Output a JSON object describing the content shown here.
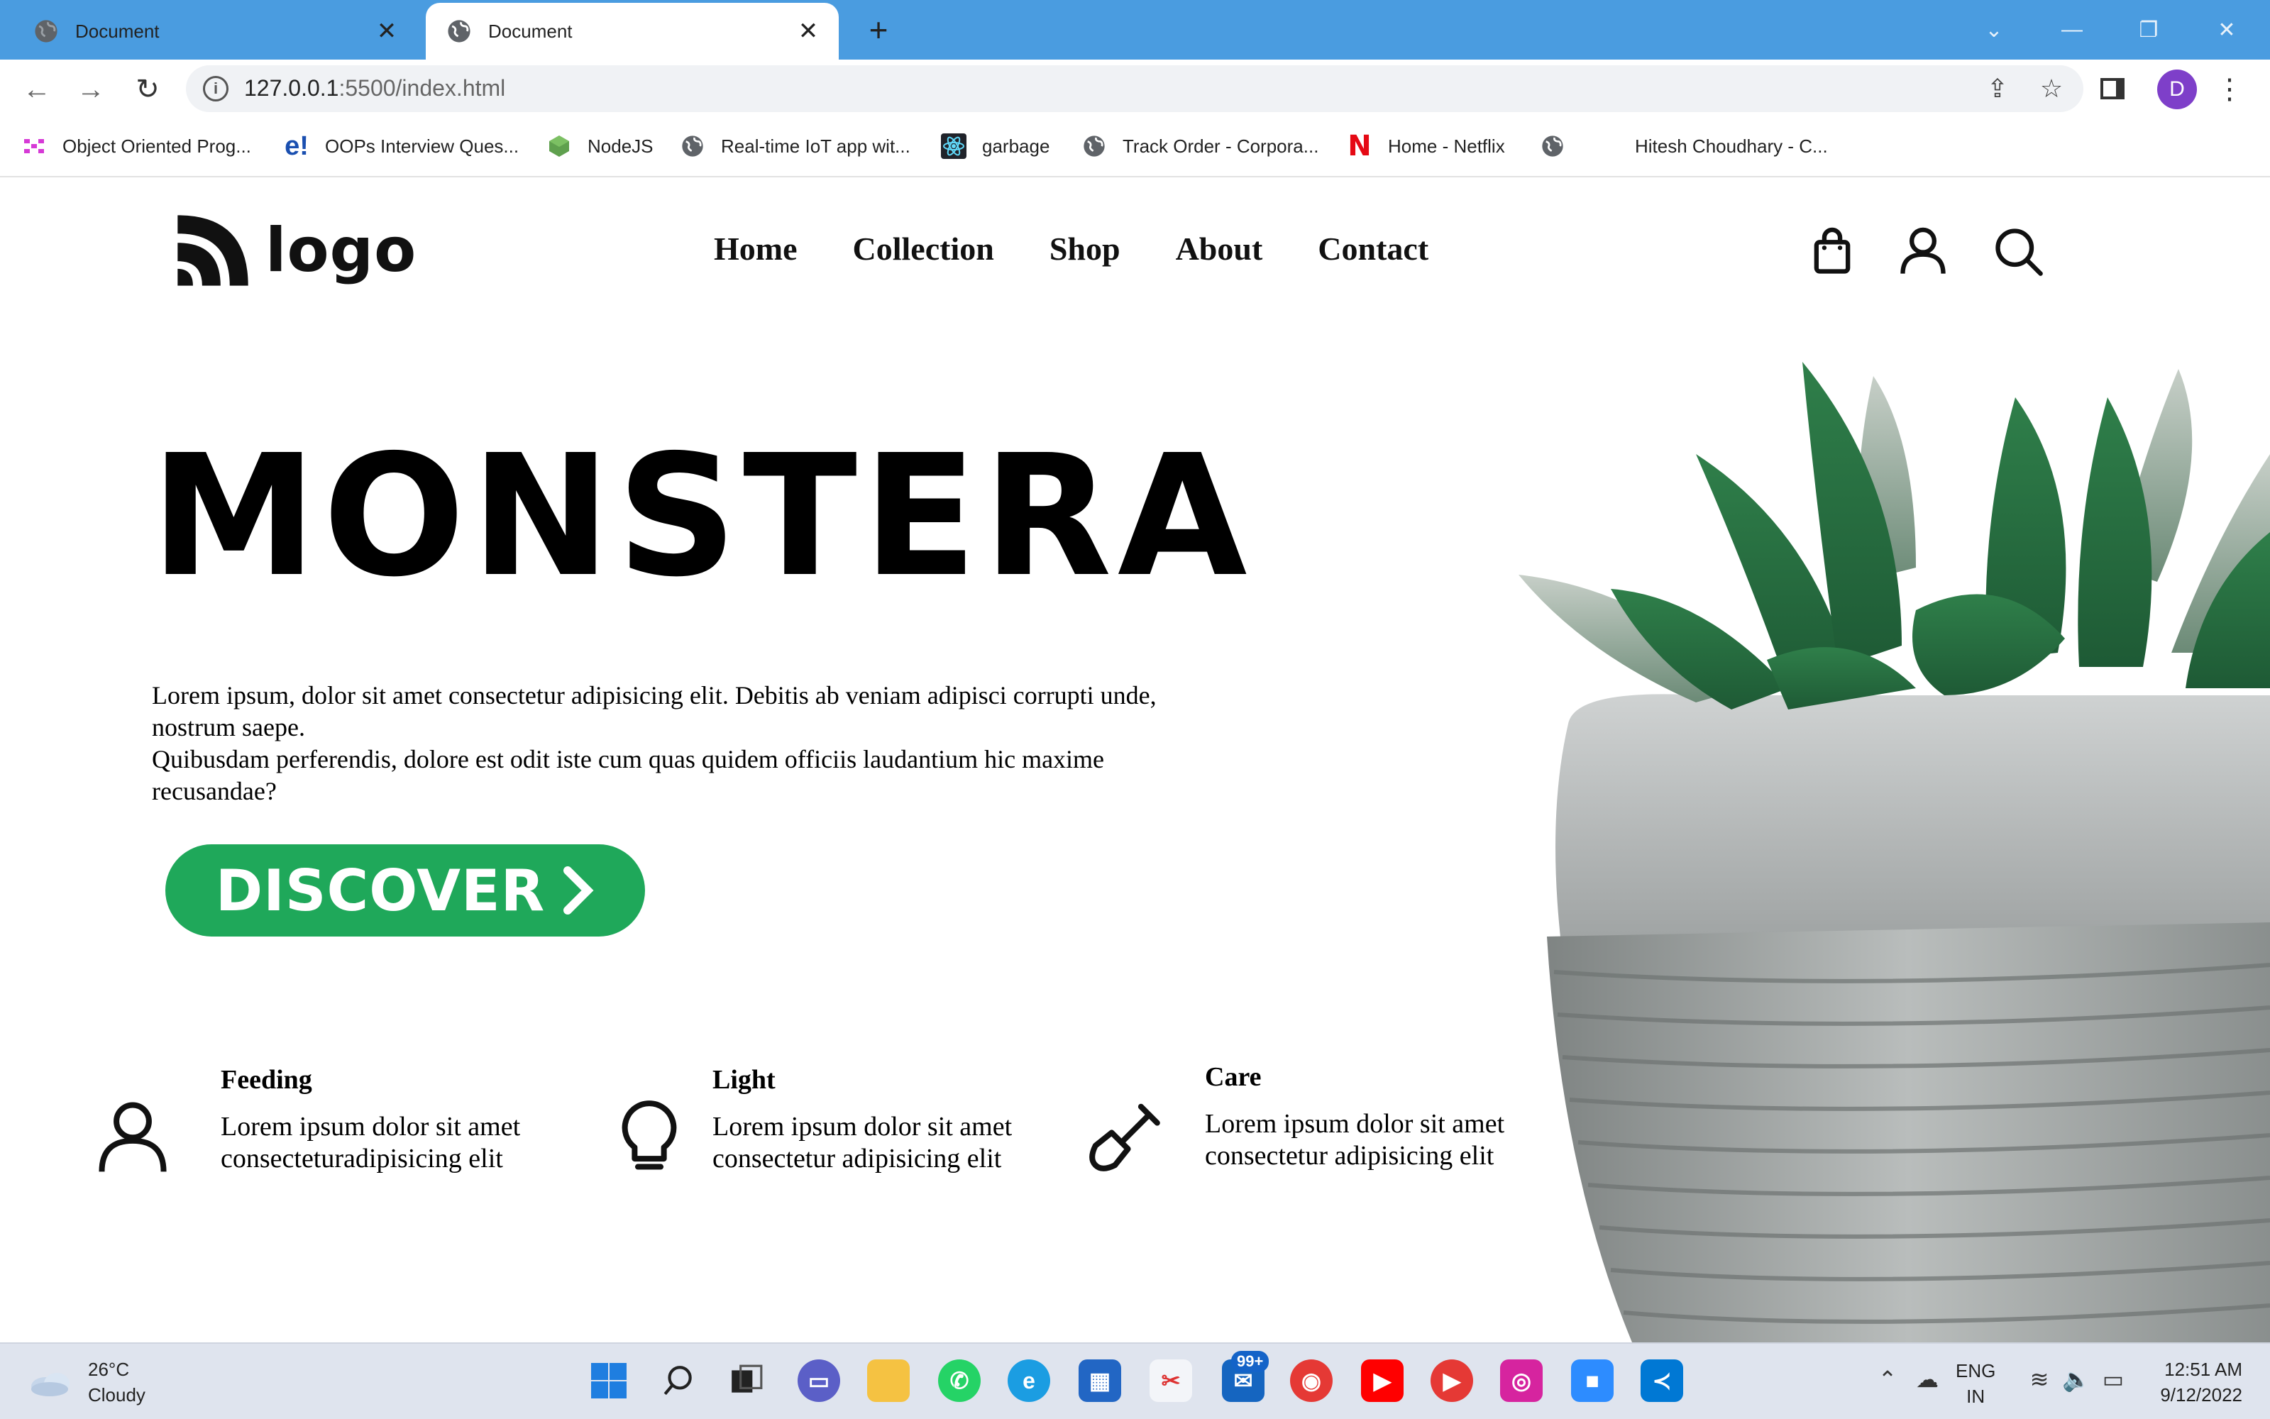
{
  "browser": {
    "tabs": [
      {
        "title": "Document",
        "active": false
      },
      {
        "title": "Document",
        "active": true
      }
    ],
    "url_host": "127.0.0.1",
    "url_path": ":5500/index.html",
    "profile_initial": "D",
    "bookmarks": [
      {
        "label": "Object Oriented Prog...",
        "icon": "dots-icon"
      },
      {
        "label": "OOPs Interview Ques...",
        "icon": "e-logo-icon",
        "glyph": "e!"
      },
      {
        "label": "NodeJS",
        "icon": "nodejs-icon"
      },
      {
        "label": "Real-time IoT app wit...",
        "icon": "globe-icon"
      },
      {
        "label": "garbage",
        "icon": "react-icon"
      },
      {
        "label": "Track Order - Corpora...",
        "icon": "globe-icon"
      },
      {
        "label": "Home - Netflix",
        "icon": "netflix-icon",
        "glyph": "N"
      },
      {
        "label": "",
        "icon": "globe-icon"
      },
      {
        "label": "Hitesh Choudhary - C...",
        "icon": "none"
      }
    ]
  },
  "site": {
    "logo_text": "logo",
    "nav": [
      "Home",
      "Collection",
      "Shop",
      "About",
      "Contact"
    ],
    "hero": {
      "title": "MONSTERA",
      "paragraph_line1": "Lorem ipsum, dolor sit amet consectetur adipisicing elit. Debitis ab veniam adipisci corrupti unde, nostrum saepe.",
      "paragraph_line2": "Quibusdam perferendis, dolore est odit iste cum quas quidem officiis laudantium hic maxime recusandae?",
      "cta_label": "DISCOVER",
      "cta_color": "#1fa85a"
    },
    "features": [
      {
        "title": "Feeding",
        "text": "Lorem ipsum dolor sit amet consecteturadipisicing elit",
        "icon": "user-icon"
      },
      {
        "title": "Light",
        "text": "Lorem ipsum dolor sit amet consectetur adipisicing elit",
        "icon": "lightbulb-icon"
      },
      {
        "title": "Care",
        "text": "Lorem ipsum dolor sit amet consectetur adipisicing elit",
        "icon": "shovel-icon"
      }
    ]
  },
  "taskbar": {
    "weather_temp": "26°C",
    "weather_desc": "Cloudy",
    "badge": "99+",
    "lang_line1": "ENG",
    "lang_line2": "IN",
    "time": "12:51 AM",
    "date": "9/12/2022"
  }
}
